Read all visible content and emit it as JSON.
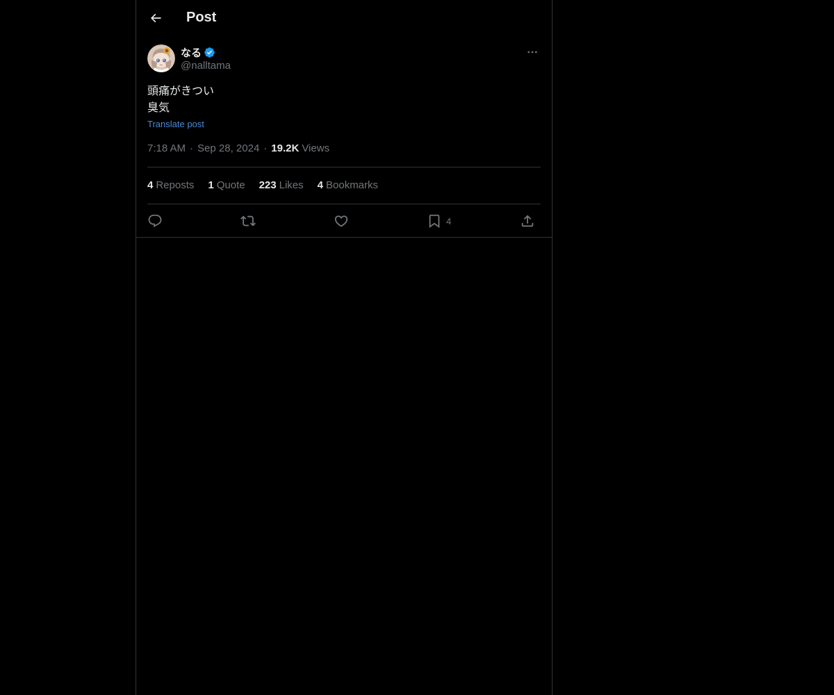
{
  "header": {
    "title": "Post",
    "back_icon": "arrow-left-icon"
  },
  "author": {
    "display_name": "なる",
    "handle": "@nalltama",
    "verified_icon": "verified-badge-icon",
    "more_icon": "more-horizontal-icon",
    "colors": {
      "verified": "#1d9bf0"
    }
  },
  "post": {
    "lines": [
      "頭痛がきつい",
      "臭気"
    ],
    "translate_label": "Translate post"
  },
  "meta": {
    "time": "7:18 AM",
    "separator": "·",
    "date": "Sep 28, 2024",
    "views_count": "19.2K",
    "views_label": "Views"
  },
  "stats": {
    "reposts": {
      "count": "4",
      "label": "Reposts"
    },
    "quotes": {
      "count": "1",
      "label": "Quote"
    },
    "likes": {
      "count": "223",
      "label": "Likes"
    },
    "bookmarks": {
      "count": "4",
      "label": "Bookmarks"
    }
  },
  "actions": {
    "reply_icon": "reply-icon",
    "repost_icon": "repost-icon",
    "like_icon": "heart-icon",
    "bookmark_icon": "bookmark-icon",
    "bookmark_count": "4",
    "share_icon": "share-icon"
  },
  "theme": {
    "background": "#000000",
    "text": "#e7e9ea",
    "muted": "#71767b",
    "border": "#2f3336",
    "link": "#4a8bd8"
  }
}
